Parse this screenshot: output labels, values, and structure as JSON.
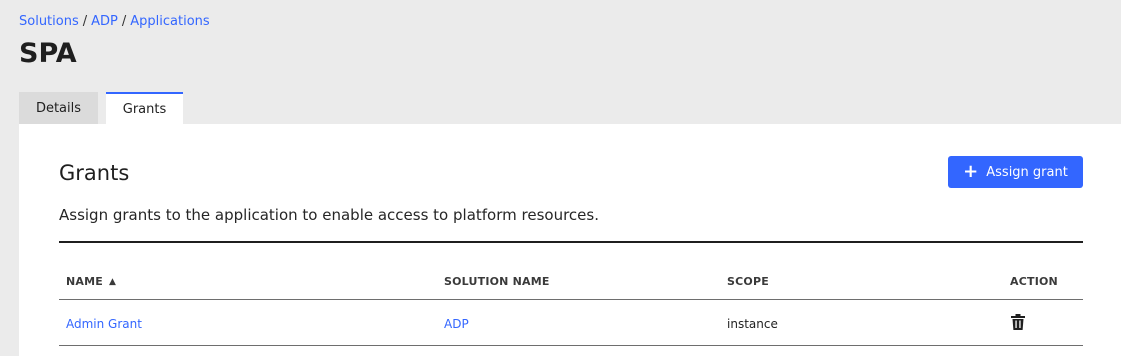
{
  "breadcrumb": {
    "items": [
      "Solutions",
      "ADP",
      "Applications"
    ],
    "separator": "/"
  },
  "page": {
    "title": "SPA"
  },
  "tabs": [
    {
      "label": "Details",
      "active": false
    },
    {
      "label": "Grants",
      "active": true
    }
  ],
  "panel": {
    "title": "Grants",
    "description": "Assign grants to the application to enable access to platform resources.",
    "assign_button": {
      "icon": "plus-icon",
      "icon_glyph": "+",
      "label": "Assign grant"
    }
  },
  "table": {
    "columns": {
      "name": "NAME",
      "solution": "SOLUTION NAME",
      "scope": "SCOPE",
      "action": "ACTION"
    },
    "sort": {
      "column": "name",
      "direction": "ascending",
      "glyph": "▲"
    },
    "rows": [
      {
        "name": "Admin Grant",
        "solution": "ADP",
        "scope": "instance",
        "action_icon": "trash-icon"
      }
    ]
  },
  "colors": {
    "accent": "#3366ff",
    "background": "#ebebeb",
    "panel": "#ffffff",
    "text": "#1f1f1f"
  }
}
